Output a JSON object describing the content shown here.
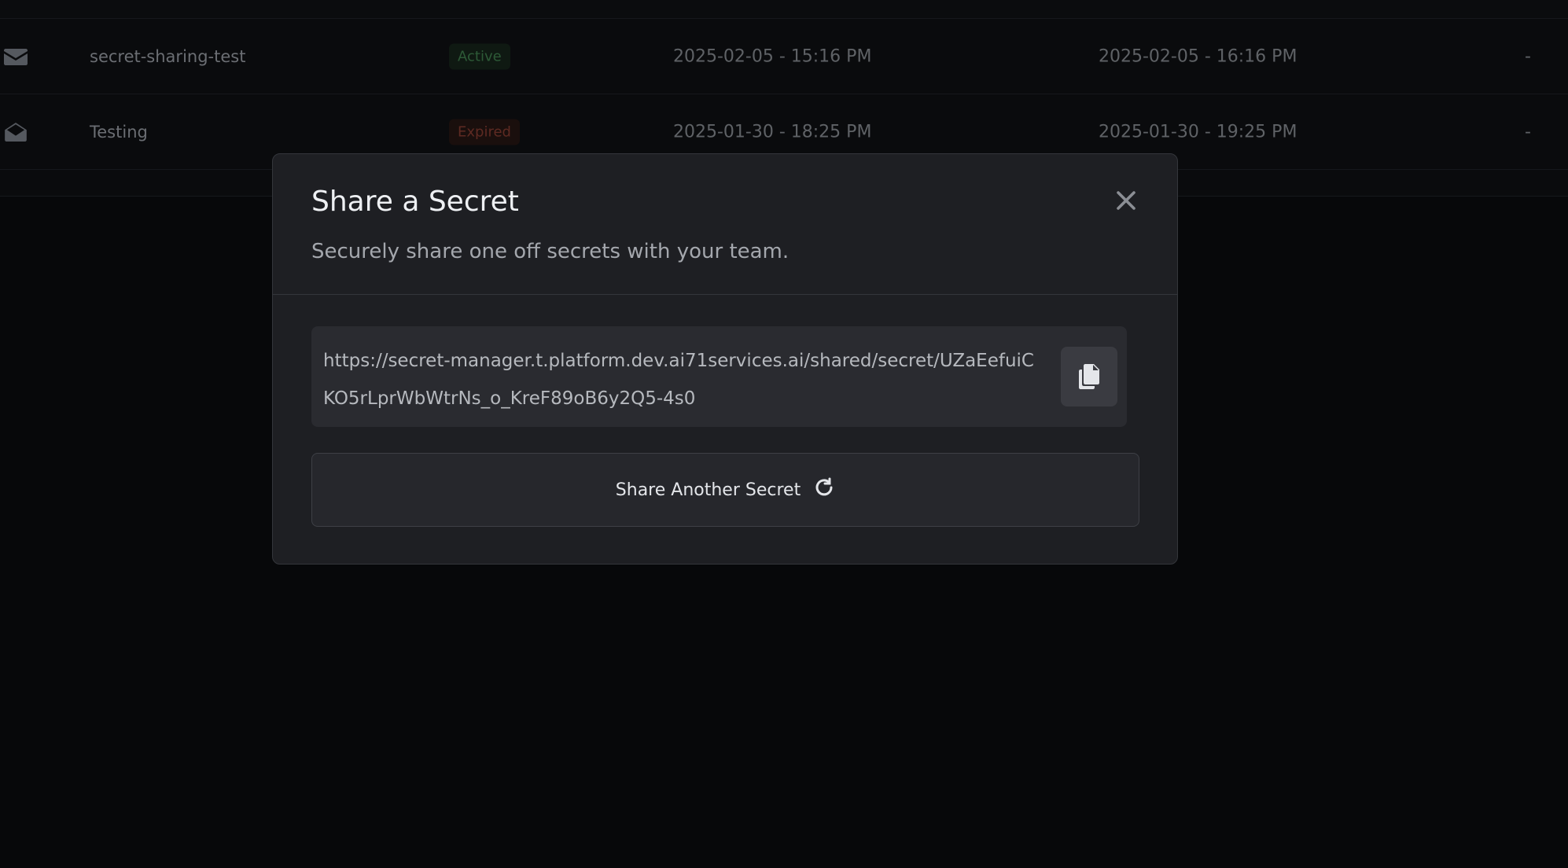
{
  "table": {
    "rows": [
      {
        "icon": "envelope-closed-icon",
        "name": "secret-sharing-test",
        "status": "Active",
        "created": "2025-02-05 - 15:16 PM",
        "expires": "2025-02-05 - 16:16 PM",
        "extra": "-"
      },
      {
        "icon": "envelope-open-icon",
        "name": "Testing",
        "status": "Expired",
        "created": "2025-01-30 - 18:25 PM",
        "expires": "2025-01-30 - 19:25 PM",
        "extra": "-"
      }
    ]
  },
  "modal": {
    "title": "Share a Secret",
    "subtitle": "Securely share one off secrets with your team.",
    "close_icon": "close-icon",
    "shared_link": "https://secret-manager.t.platform.dev.ai71services.ai/shared/secret/UZaEefuiCKO5rLprWbWtrNs_o_KreF89oB6y2Q5-4s0",
    "copy_icon": "copy-icon",
    "share_another_label": "Share Another Secret",
    "share_another_icon": "refresh-icon"
  },
  "colors": {
    "background": "#07080a",
    "modal_bg": "#1e1f23",
    "active_status": "#2d5a37",
    "expired_status": "#5e2a22"
  }
}
